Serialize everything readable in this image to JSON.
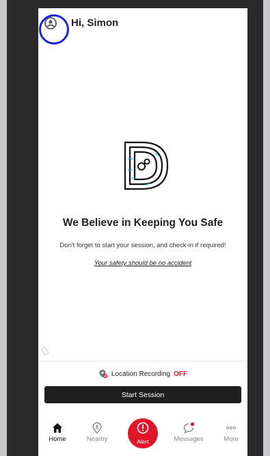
{
  "header": {
    "greeting": "Hi, Simon"
  },
  "main": {
    "tagline": "We Believe in Keeping You Safe",
    "subtext": "Don't forget to start your session, and check-in if required!",
    "motto": "Your safety should be no accident"
  },
  "location": {
    "label": "Location Recording",
    "status": "OFF"
  },
  "session": {
    "start_label": "Start Session"
  },
  "nav": {
    "items": [
      {
        "label": "Home",
        "icon": "home-icon"
      },
      {
        "label": "Nearby",
        "icon": "location-pin-icon"
      },
      {
        "label": "Alert",
        "icon": "alert-icon"
      },
      {
        "label": "Messages",
        "icon": "message-icon"
      },
      {
        "label": "More",
        "icon": "more-icon"
      }
    ]
  },
  "colors": {
    "accent": "#e0162b",
    "highlight": "#1a24d6",
    "button": "#1e1e1e"
  }
}
